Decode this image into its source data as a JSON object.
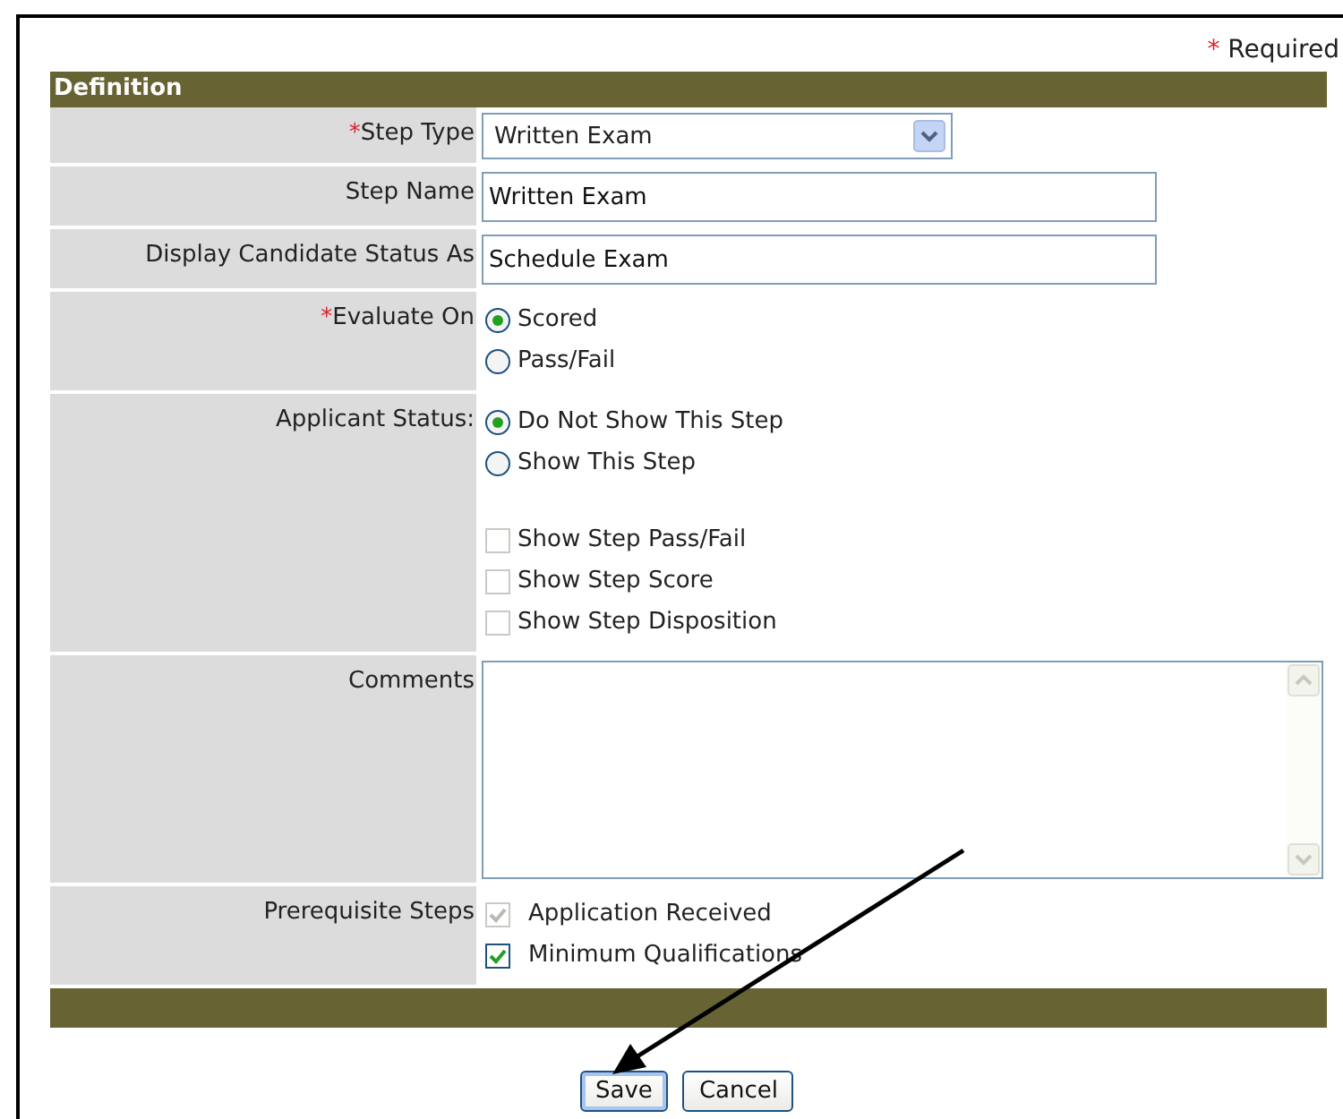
{
  "required_note": {
    "mark": "*",
    "text": "Required"
  },
  "section": {
    "title": "Definition"
  },
  "fields": [
    {
      "kind": "select",
      "required_mark": "*",
      "label": "Step Type",
      "value": "Written Exam"
    },
    {
      "kind": "text",
      "label": "Step Name",
      "value": "Written Exam"
    },
    {
      "kind": "text",
      "label": "Display Candidate Status As",
      "value": "Schedule Exam"
    },
    {
      "kind": "options",
      "required_mark": "*",
      "label": "Evaluate On",
      "options": [
        {
          "label": "Scored",
          "selected": true
        },
        {
          "label": "Pass/Fail",
          "selected": false
        }
      ]
    },
    {
      "kind": "options",
      "label": "Applicant Status:",
      "options": [
        {
          "label": "Do Not Show This Step",
          "selected": true
        },
        {
          "label": "Show This Step",
          "selected": false
        }
      ],
      "checks": [
        {
          "label": "Show Step Pass/Fail",
          "checked": false,
          "disabled": true
        },
        {
          "label": "Show Step Score",
          "checked": false,
          "disabled": true
        },
        {
          "label": "Show Step Disposition",
          "checked": false,
          "disabled": true
        }
      ]
    },
    {
      "kind": "textarea",
      "label": "Comments"
    },
    {
      "kind": "options",
      "label": "Prerequisite Steps",
      "checks": [
        {
          "label": "Application Received",
          "checked": true,
          "disabled": true
        },
        {
          "label": "Minimum Qualifications",
          "checked": true,
          "disabled": false
        }
      ]
    }
  ],
  "buttons": [
    {
      "label": "Save",
      "selected": true
    },
    {
      "label": "Cancel",
      "selected": false
    }
  ]
}
